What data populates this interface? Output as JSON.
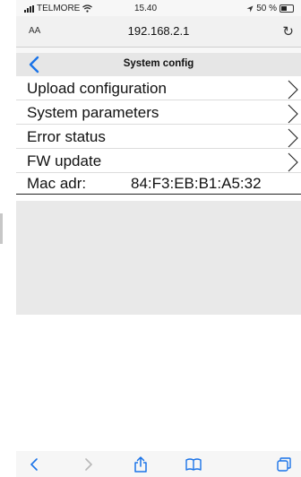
{
  "status_bar": {
    "carrier": "TELMORE",
    "time": "15.40",
    "battery": "50 %"
  },
  "address_bar": {
    "aa_label": "AA",
    "url": "192.168.2.1"
  },
  "page": {
    "title": "System config",
    "menu_items": [
      {
        "label": "Upload configuration"
      },
      {
        "label": "System parameters"
      },
      {
        "label": "Error status"
      },
      {
        "label": "FW update"
      }
    ],
    "mac_label": "Mac adr:",
    "mac_value": "84:F3:EB:B1:A5:32"
  },
  "toolbar": {
    "icons": [
      "back-icon",
      "forward-icon",
      "share-icon",
      "bookmarks-icon",
      "tabs-icon"
    ]
  },
  "colors": {
    "accent": "#1a73e8",
    "header_bg": "#e6e6e6",
    "panel_bg": "#e9e9e9"
  }
}
